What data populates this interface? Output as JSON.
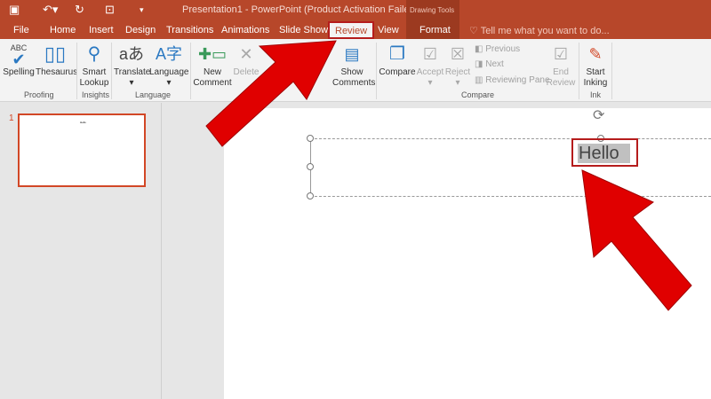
{
  "titlebar": {
    "title": "Presentation1 - PowerPoint (Product Activation Failed)",
    "context": "Drawing Tools",
    "icons": [
      "save-icon",
      "undo-icon",
      "redo-icon",
      "present-icon",
      "customize-icon"
    ]
  },
  "tabs": [
    {
      "label": "File"
    },
    {
      "label": "Home"
    },
    {
      "label": "Insert"
    },
    {
      "label": "Design"
    },
    {
      "label": "Transitions"
    },
    {
      "label": "Animations"
    },
    {
      "label": "Slide Show"
    },
    {
      "label": "Review"
    },
    {
      "label": "View"
    },
    {
      "label": "Format"
    }
  ],
  "tell": "Tell me what you want to do...",
  "ribbon": {
    "spelling": "Spelling",
    "thesaurus": "Thesaurus",
    "proofing": "Proofing",
    "smart1": "Smart",
    "smart2": "Lookup",
    "insights": "Insights",
    "translate": "Translate",
    "language_btn": "Language",
    "language": "Language",
    "new1": "New",
    "new2": "Comment",
    "delete": "Delete",
    "show1": "Show",
    "show2": "Comments",
    "compare_btn": "Compare",
    "accept": "Accept",
    "reject": "Reject",
    "previous": "Previous",
    "next": "Next",
    "pane": "Reviewing Pane",
    "end1": "End",
    "end2": "Review",
    "compare": "Compare",
    "start1": "Start",
    "start2": "Inking",
    "ink": "Ink"
  },
  "slides": {
    "number": "1",
    "thumb_text": "Hello"
  },
  "slide": {
    "text": "Hello"
  },
  "colors": {
    "accent": "#b7472a",
    "highlight": "#b51c1c",
    "arrow": "#e00000"
  }
}
